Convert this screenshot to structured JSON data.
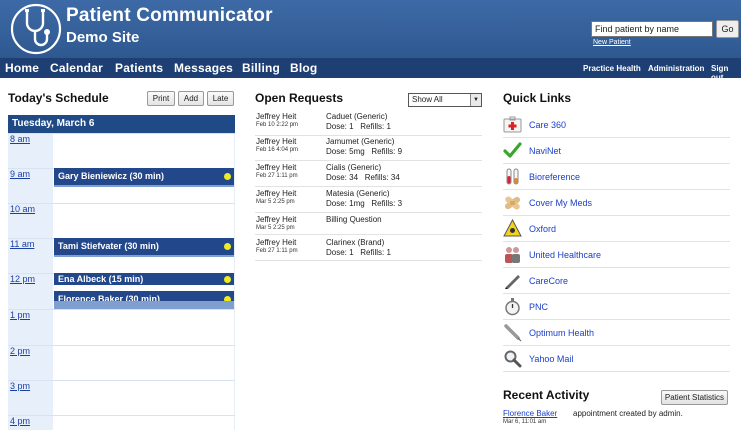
{
  "header": {
    "title": "Patient Communicator",
    "subtitle": "Demo Site",
    "search_placeholder": "Find patient by name",
    "go_label": "Go",
    "new_patient": "New Patient"
  },
  "nav": {
    "items": [
      {
        "label": "Home"
      },
      {
        "label": "Calendar"
      },
      {
        "label": "Patients"
      },
      {
        "label": "Messages"
      },
      {
        "label": "Billing"
      },
      {
        "label": "Blog"
      }
    ],
    "right": [
      {
        "label": "Practice Health"
      },
      {
        "label": "Administration"
      },
      {
        "label": "Sign out"
      }
    ]
  },
  "schedule": {
    "title": "Today's Schedule",
    "buttons": [
      "Print",
      "Add",
      "Late"
    ],
    "day": "Tuesday, March 6",
    "hours": [
      "8 am",
      "9 am",
      "10 am",
      "11 am",
      "12 pm",
      "1 pm",
      "2 pm",
      "3 pm",
      "4 pm"
    ],
    "appointments": [
      {
        "label": "Gary Bieniewicz (30 min)"
      },
      {
        "label": "Tami Stiefvater (30 min)"
      },
      {
        "label": "Ena Albeck (15 min)"
      },
      {
        "label": "Florence Baker (30 min)"
      }
    ]
  },
  "requests": {
    "title": "Open Requests",
    "filter": "Show All",
    "items": [
      {
        "name": "Jeffrey Heit",
        "date": "Feb 10 2:22 pm",
        "drug": "Caduet (Generic)",
        "detail": "Dose: 1   Refills: 1"
      },
      {
        "name": "Jeffrey Heit",
        "date": "Feb 16 4:04 pm",
        "drug": "Jamumet (Generic)",
        "detail": "Dose: 5mg   Refills: 9"
      },
      {
        "name": "Jeffrey Heit",
        "date": "Feb 27 1:11 pm",
        "drug": "Cialis (Generic)",
        "detail": "Dose: 34   Refills: 34"
      },
      {
        "name": "Jeffrey Heit",
        "date": "Mar 5 2:25 pm",
        "drug": "Matesia (Generic)",
        "detail": "Dose: 1mg   Refills: 3"
      },
      {
        "name": "Jeffrey Heit",
        "date": "Mar 5 2:25 pm",
        "drug": "Billing Question",
        "detail": ""
      },
      {
        "name": "Jeffrey Heit",
        "date": "Feb 27 1:11 pm",
        "drug": "Clarinex (Brand)",
        "detail": "Dose: 1   Refills: 1"
      }
    ]
  },
  "quick_links": {
    "title": "Quick Links",
    "items": [
      {
        "label": "Care 360",
        "icon": "first-aid-kit-icon"
      },
      {
        "label": "NaviNet",
        "icon": "checkmark-icon"
      },
      {
        "label": "Bioreference",
        "icon": "test-tubes-icon"
      },
      {
        "label": "Cover My Meds",
        "icon": "bandage-icon"
      },
      {
        "label": "Oxford",
        "icon": "hazard-icon"
      },
      {
        "label": "United Healthcare",
        "icon": "people-icon"
      },
      {
        "label": "CareCore",
        "icon": "pen-icon"
      },
      {
        "label": "PNC",
        "icon": "stopwatch-icon"
      },
      {
        "label": "Optimum Health",
        "icon": "syringe-icon"
      },
      {
        "label": "Yahoo Mail",
        "icon": "magnifier-icon"
      }
    ]
  },
  "recent": {
    "title": "Recent Activity",
    "button": "Patient Statistics",
    "items": [
      {
        "name": "Florence Baker",
        "date": "Mar 6, 11:01 am",
        "text": "appointment created by admin."
      }
    ]
  },
  "colors": {
    "header": "#2f5890",
    "nav": "#1d3f73",
    "appointment": "#23478b",
    "link": "#1a3fc8"
  }
}
